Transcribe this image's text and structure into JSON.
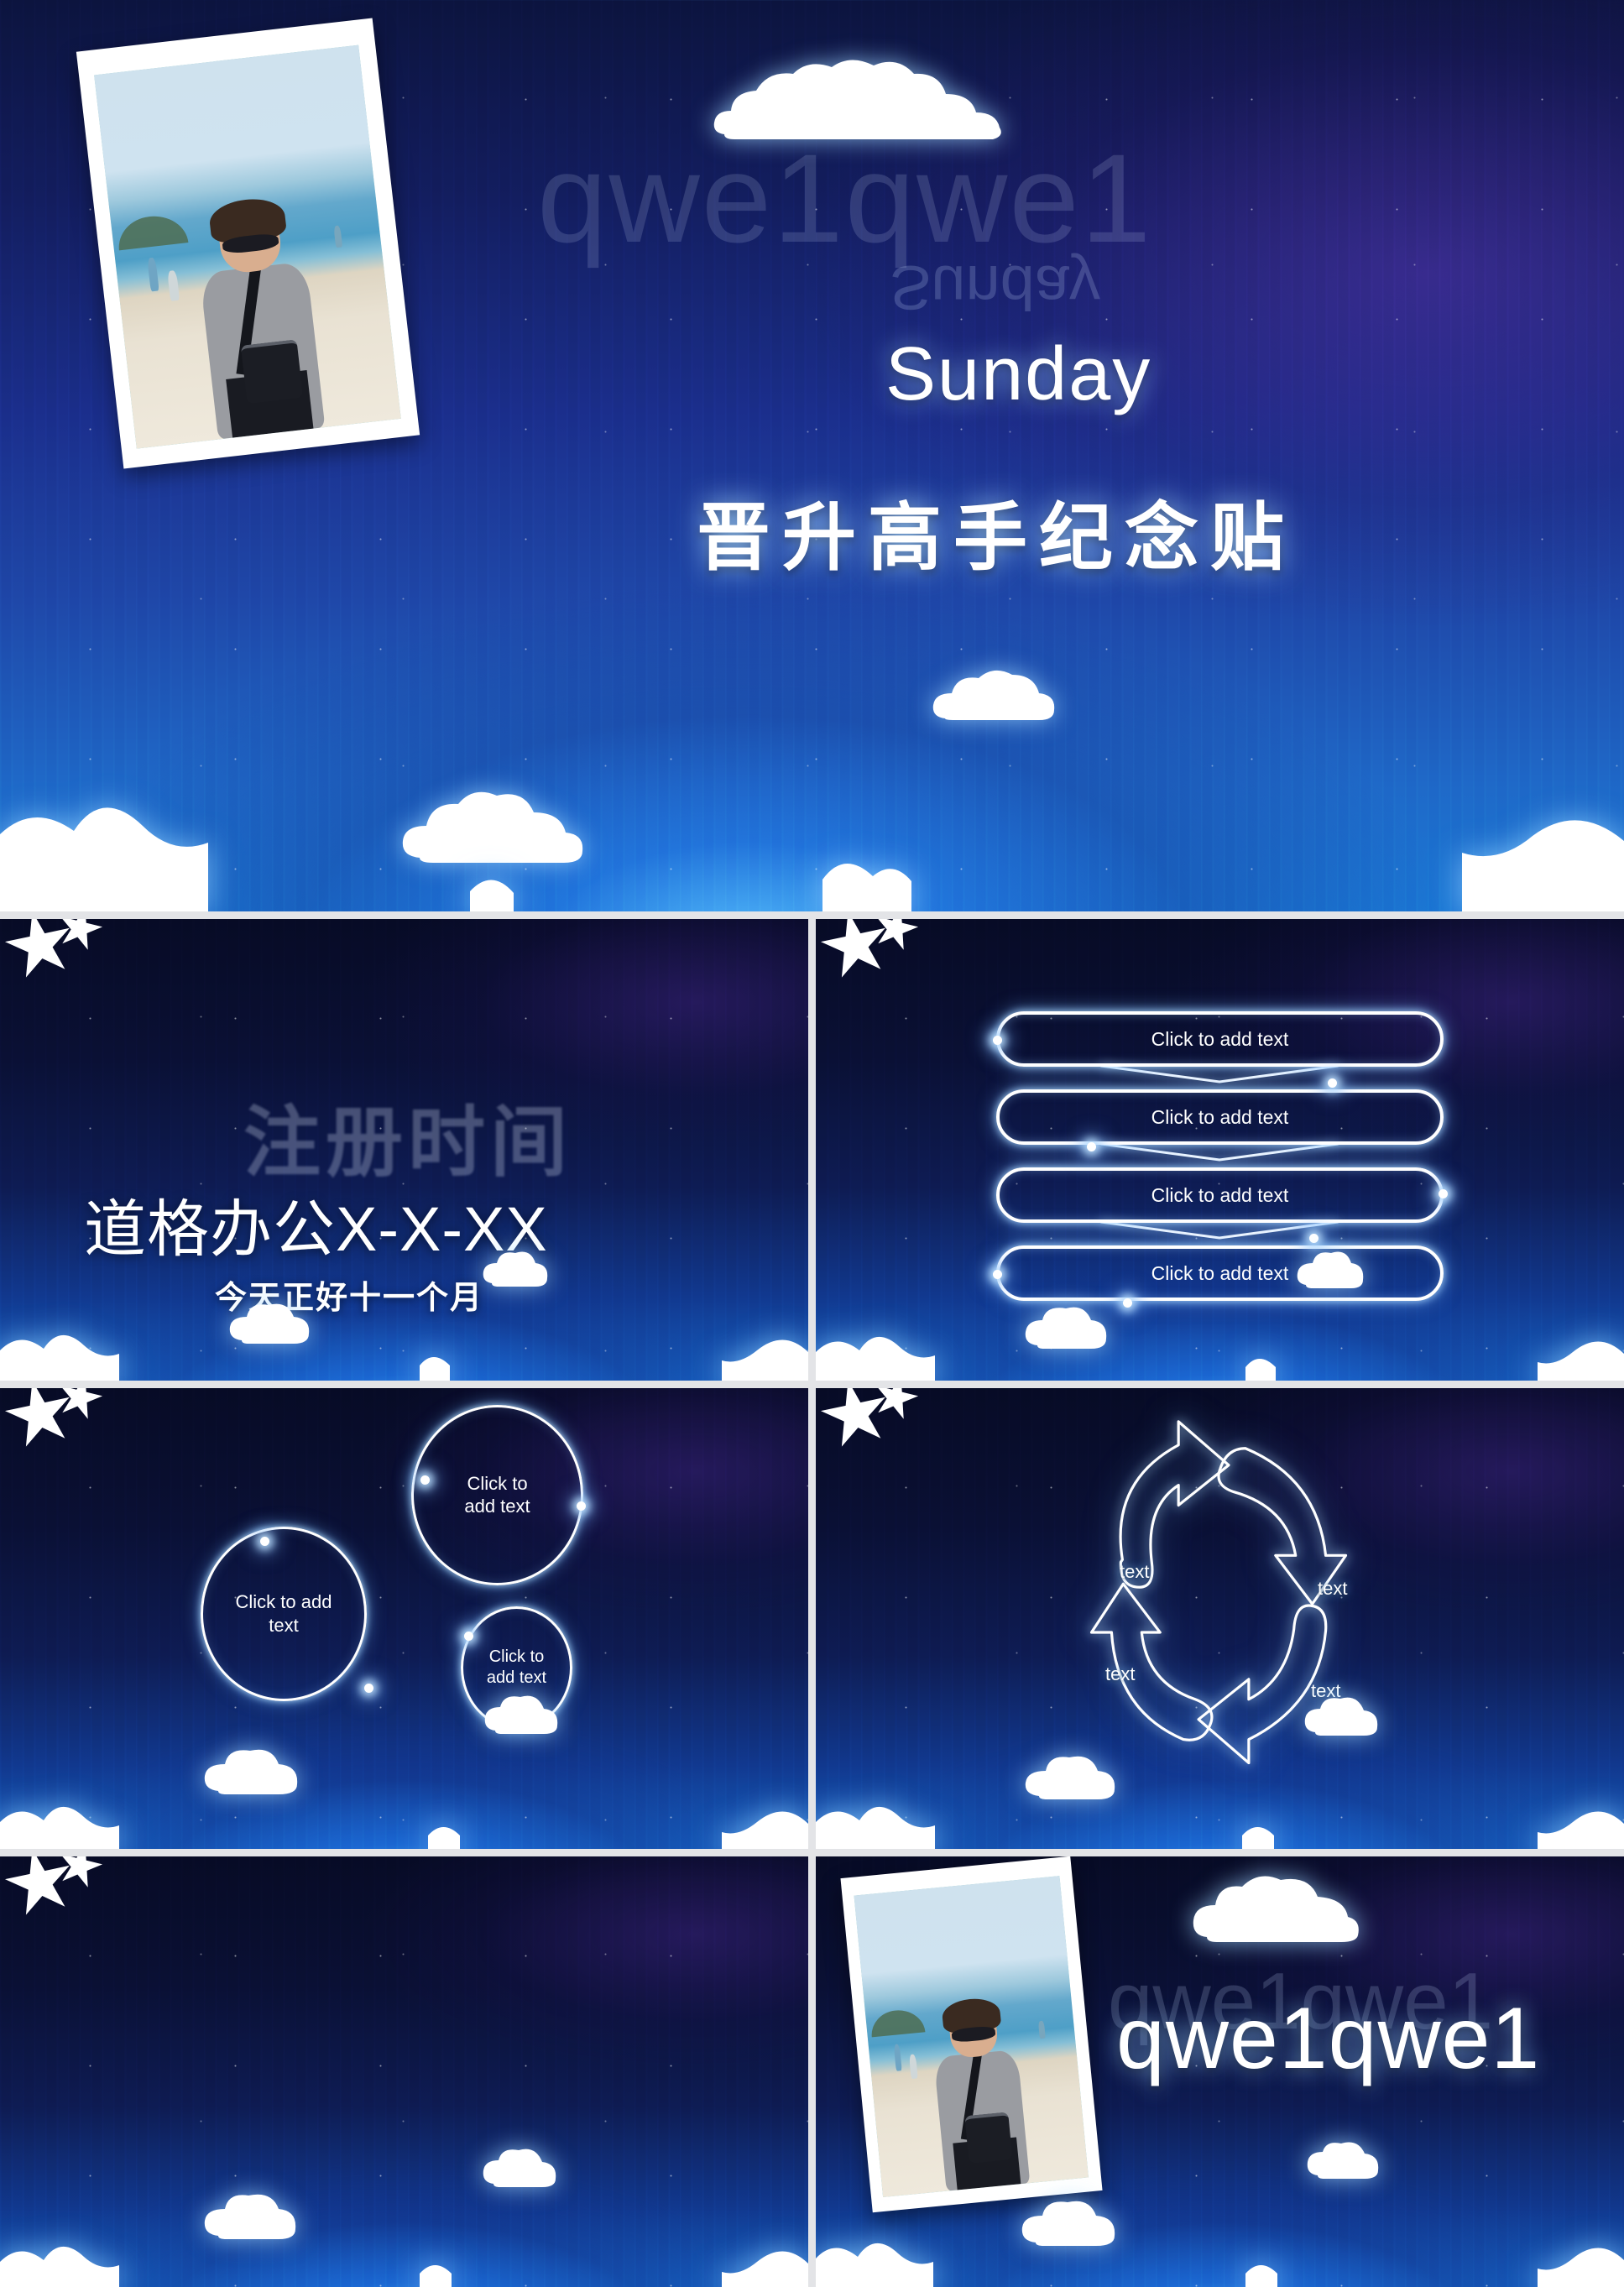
{
  "deck": {
    "slide_count": 7,
    "accent_white": "#ffffff",
    "bg_deep_navy": "#0a1030",
    "bg_blue_glow": "#1663c4",
    "gutter_color": "#e3e4e7"
  },
  "slide1": {
    "name": "title-slide",
    "day_label": "Sunday",
    "title_cn": "晋升高手纪念贴",
    "watermark": "qwe1qwe1",
    "reflection": "Sunday",
    "photo_alt": "beach-photo"
  },
  "slide2": {
    "name": "registration-time-slide",
    "ghost_heading": "注册时间",
    "title": "道格办公X-X-XX",
    "subtitle": "今天正好十一个月"
  },
  "slide3": {
    "name": "four-pill-list-slide",
    "items": [
      {
        "label": "Click to add text"
      },
      {
        "label": "Click to add text"
      },
      {
        "label": "Click to add text"
      },
      {
        "label": "Click to add text"
      }
    ]
  },
  "slide4": {
    "name": "three-circle-slide",
    "items": [
      {
        "label": "Click to add\ntext"
      },
      {
        "label": "Click to\nadd text"
      },
      {
        "label": "Click to\nadd text"
      }
    ]
  },
  "slide5": {
    "name": "four-step-cycle-slide",
    "labels": [
      {
        "label": "text"
      },
      {
        "label": "text"
      },
      {
        "label": "text"
      },
      {
        "label": "text"
      }
    ]
  },
  "slide6": {
    "name": "blank-slide",
    "content": ""
  },
  "slide7": {
    "name": "closing-photo-slide",
    "text": "qwe1qwe1",
    "ghost_text": "qwe1qwe1",
    "photo_alt": "beach-photo"
  }
}
